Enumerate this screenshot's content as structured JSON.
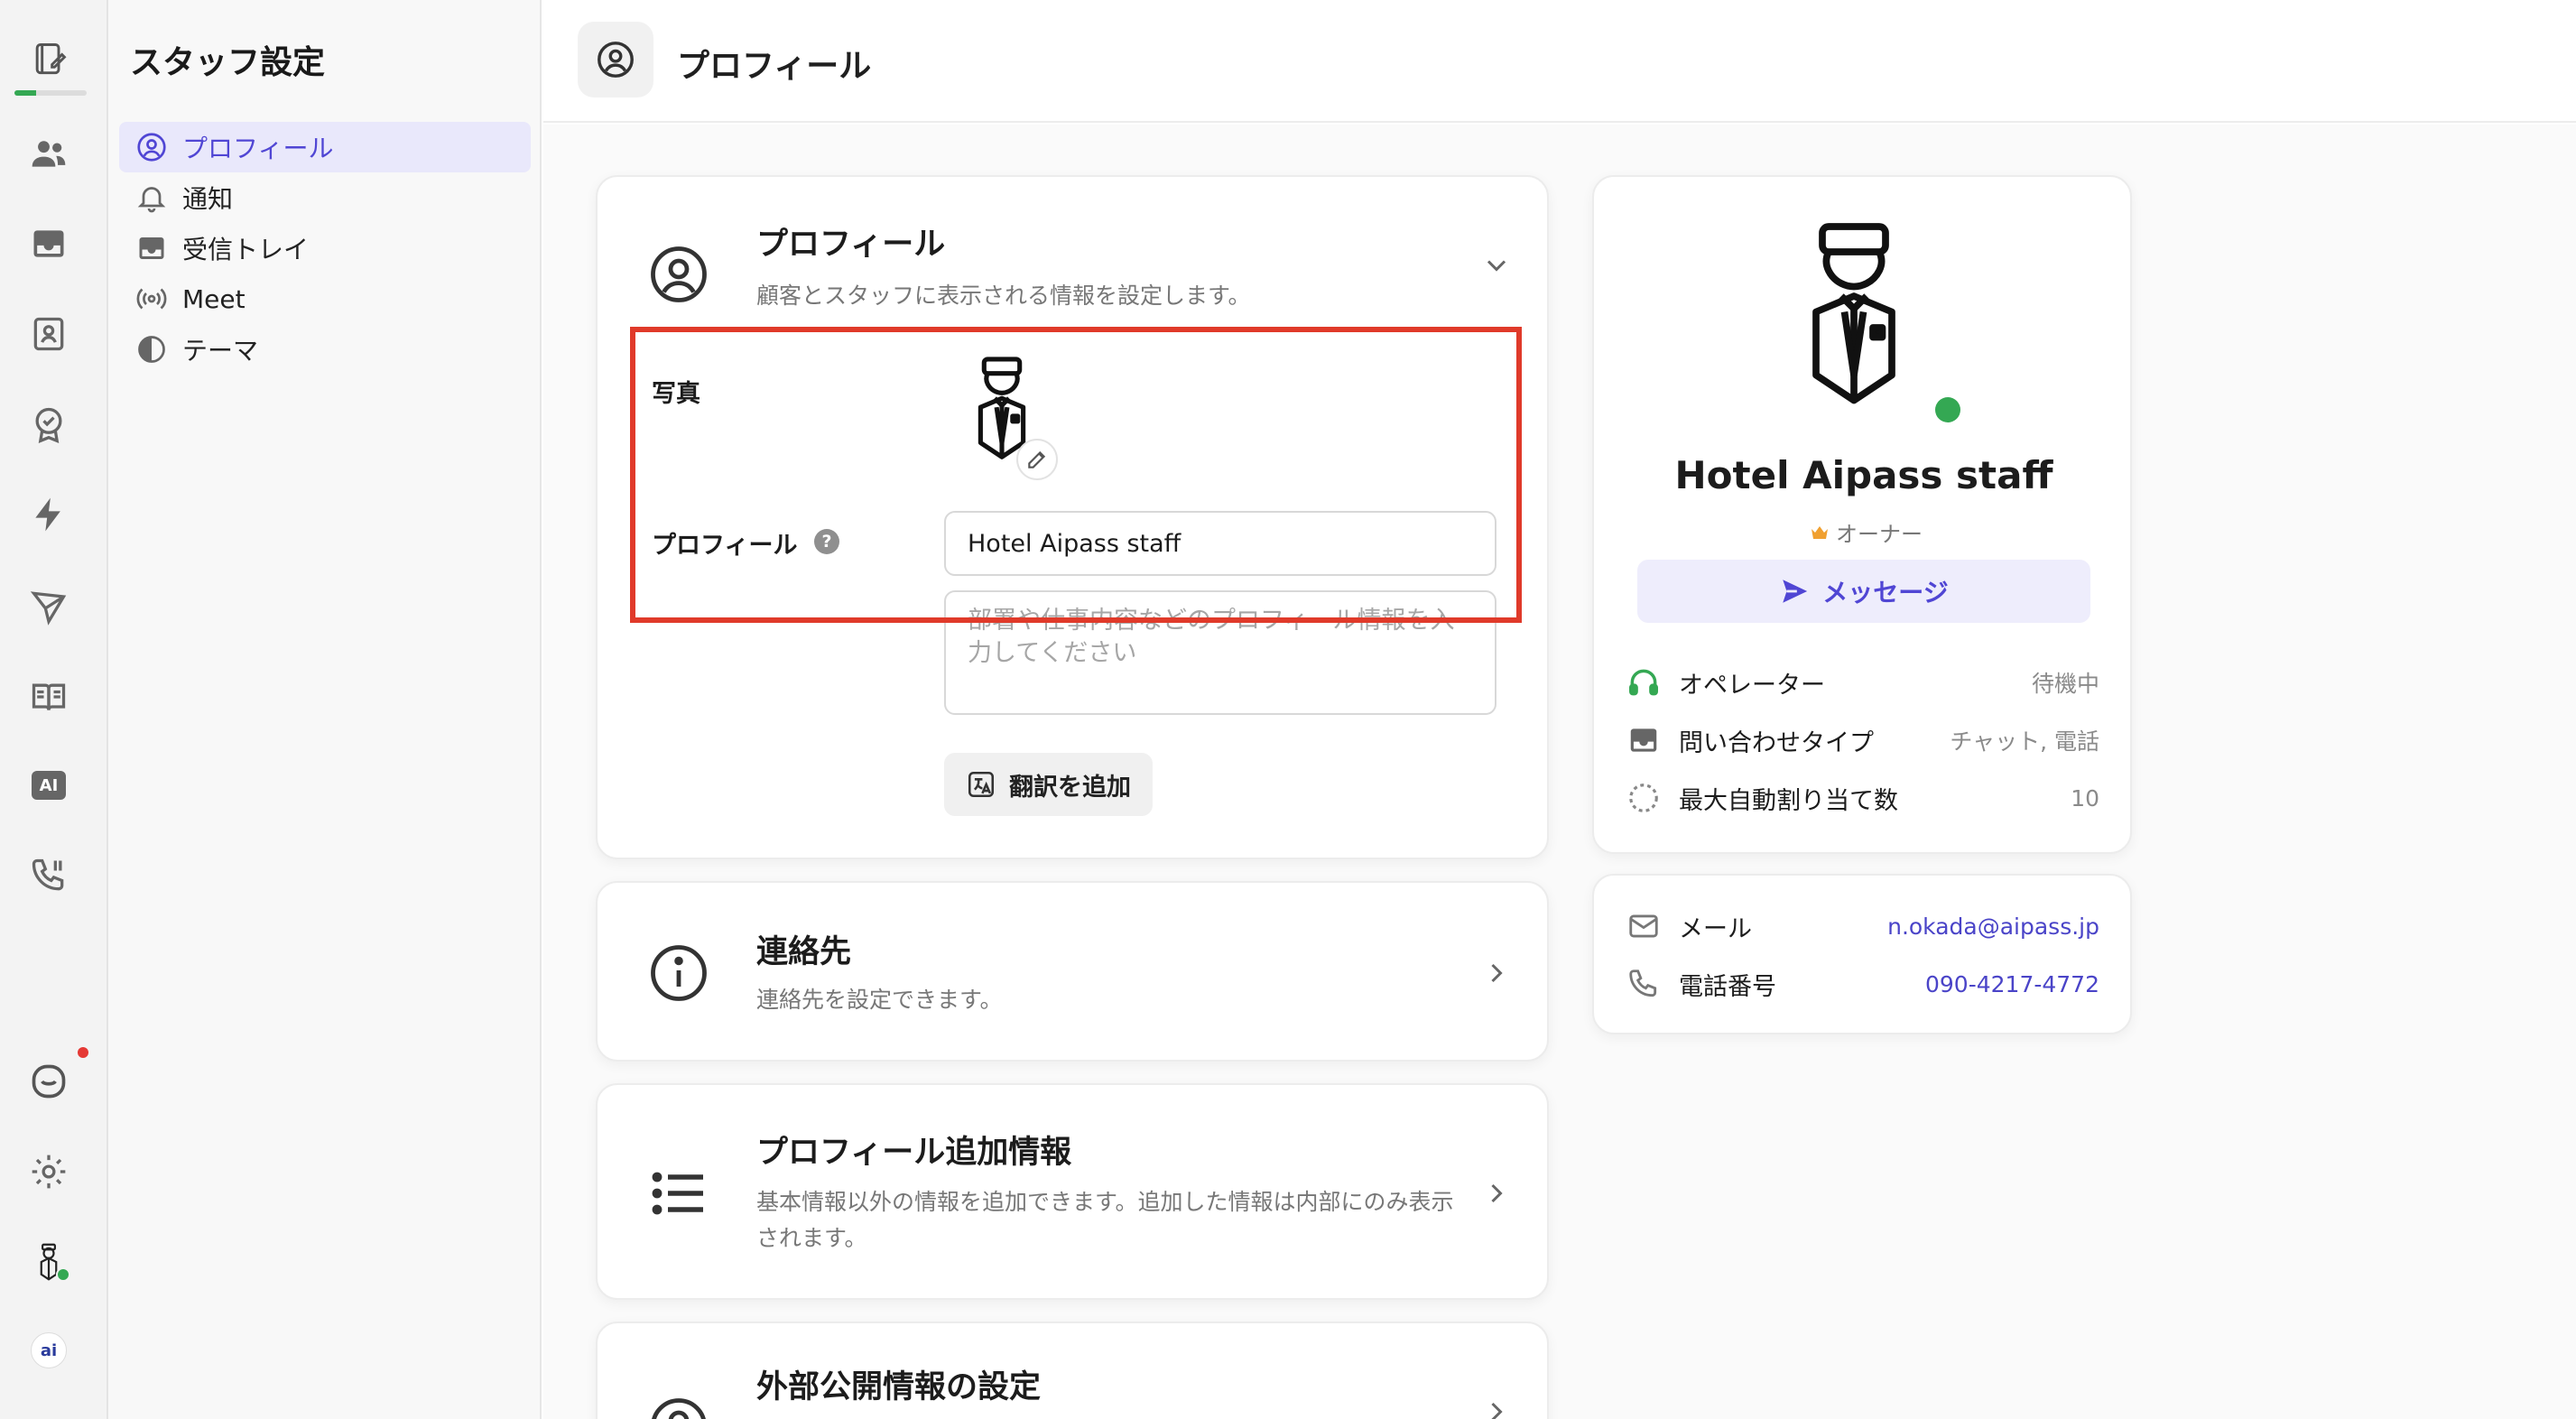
{
  "rail": {
    "progress": 0.3,
    "items": [
      "notebook-edit-icon",
      "users-icon",
      "inbox-icon",
      "contact-card-icon",
      "badge-check-icon",
      "lightning-icon",
      "send-icon",
      "book-icon",
      "ai-icon",
      "phone-icon"
    ],
    "bottom": [
      "chat-icon",
      "gear-icon",
      "avatar",
      "aipass-logo"
    ],
    "ai_label": "AI",
    "logo_label": "ai"
  },
  "sidebar": {
    "title": "スタッフ設定",
    "items": [
      {
        "label": "プロフィール",
        "icon": "user-circle-icon",
        "active": true
      },
      {
        "label": "通知",
        "icon": "bell-icon"
      },
      {
        "label": "受信トレイ",
        "icon": "inbox-icon"
      },
      {
        "label": "Meet",
        "icon": "broadcast-icon"
      },
      {
        "label": "テーマ",
        "icon": "theme-icon"
      }
    ]
  },
  "header": {
    "title": "プロフィール"
  },
  "profile_card": {
    "title": "プロフィール",
    "description": "顧客とスタッフに表示される情報を設定します。",
    "photo_label": "写真",
    "profile_label": "プロフィール",
    "help": "?",
    "name_value": "Hotel Aipass staff",
    "bio_placeholder": "部署や仕事内容などのプロフィール情報を入力してください",
    "translate_button": "翻訳を追加"
  },
  "contact_card": {
    "title": "連絡先",
    "description": "連絡先を設定できます。"
  },
  "extra_card": {
    "title": "プロフィール追加情報",
    "description": "基本情報以外の情報を追加できます。追加した情報は内部にのみ表示されます。"
  },
  "public_card": {
    "title": "外部公開情報の設定"
  },
  "summary": {
    "name": "Hotel Aipass staff",
    "role": "オーナー",
    "status_color": "#34a853",
    "message_button": "メッセージ",
    "rows": [
      {
        "label": "オペレーター",
        "value": "待機中"
      },
      {
        "label": "問い合わせタイプ",
        "value": "チャット, 電話"
      },
      {
        "label": "最大自動割り当て数",
        "value": "10"
      }
    ]
  },
  "contact_info": {
    "rows": [
      {
        "label": "メール",
        "value": "n.okada@aipass.jp"
      },
      {
        "label": "電話番号",
        "value": "090-4217-4772"
      }
    ]
  },
  "colors": {
    "accent": "#5046d4",
    "highlight": "#e03a2a",
    "online": "#34a853"
  }
}
